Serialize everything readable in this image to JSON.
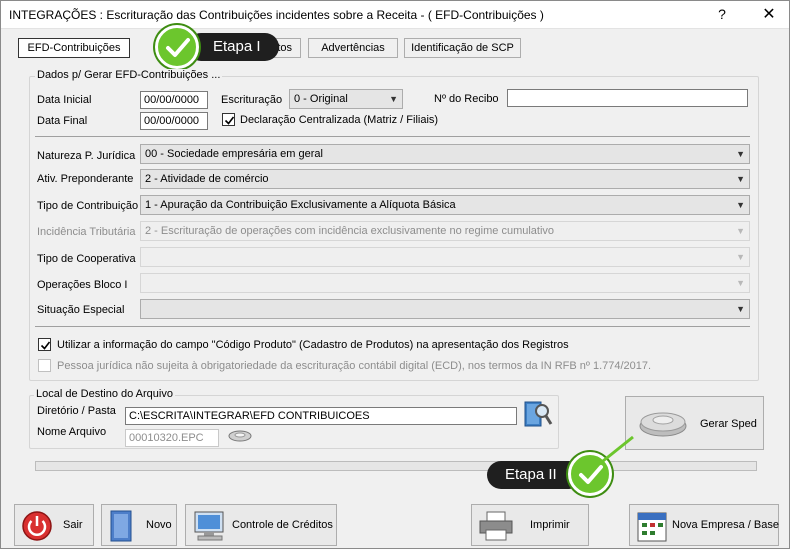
{
  "window": {
    "title": "INTEGRAÇÕES : Escrituração das Contribuições incidentes sobre a Receita - ( EFD-Contribuições )",
    "help": "?",
    "close": "✕"
  },
  "tabs": [
    {
      "label": "EFD-Contribuições",
      "active": true
    },
    {
      "label": "tos",
      "active": false
    },
    {
      "label": "Advertências",
      "active": false
    },
    {
      "label": "Identificação de SCP",
      "active": false
    }
  ],
  "callouts": {
    "etapa1": "Etapa I",
    "etapa2": "Etapa II"
  },
  "dados": {
    "legend": "Dados p/ Gerar EFD-Contribuições ...",
    "data_inicial_label": "Data Inicial",
    "data_inicial_value": "00/00/0000",
    "data_final_label": "Data Final",
    "data_final_value": "00/00/0000",
    "escrituracao_label": "Escrituração",
    "escrituracao_value": "0 - Original",
    "recibo_label": "Nº do Recibo",
    "recibo_value": "",
    "declaracao_label": "Declaração Centralizada (Matriz / Filiais)",
    "declaracao_checked": true,
    "natureza_label": "Natureza P. Jurídica",
    "natureza_value": "00 - Sociedade empresária em geral",
    "ativ_label": "Ativ. Preponderante",
    "ativ_value": "2 - Atividade de comércio",
    "tipo_contrib_label": "Tipo de Contribuição",
    "tipo_contrib_value": "1 - Apuração da Contribuição Exclusivamente a Alíquota Básica",
    "incidencia_label": "Incidência Tributária",
    "incidencia_value": "2 - Escrituração de operações com incidência exclusivamente no regime cumulativo",
    "cooperativa_label": "Tipo de Cooperativa",
    "cooperativa_value": "",
    "bloco_label": "Operações Bloco I",
    "bloco_value": "",
    "situacao_label": "Situação Especial",
    "situacao_value": "",
    "codigo_produto_label": "Utilizar a informação do campo \"Código Produto\" (Cadastro de Produtos) na apresentação dos Registros",
    "codigo_produto_checked": true,
    "pessoa_juridica_label": "Pessoa jurídica não sujeita à obrigatoriedade da escrituração contábil digital (ECD), nos termos da IN RFB nº 1.774/2017.",
    "pessoa_juridica_checked": false
  },
  "destino": {
    "legend": "Local de Destino do Arquivo",
    "diretorio_label": "Diretório / Pasta",
    "diretorio_value": "C:\\ESCRITA\\INTEGRAR\\EFD CONTRIBUICOES",
    "arquivo_label": "Nome Arquivo",
    "arquivo_value": "00010320.EPC"
  },
  "buttons": {
    "gerar_sped": "Gerar Sped",
    "sair": "Sair",
    "novo": "Novo",
    "controle_creditos": "Controle de Créditos",
    "imprimir": "Imprimir",
    "nova_empresa": "Nova Empresa / Base"
  },
  "progress": 0
}
